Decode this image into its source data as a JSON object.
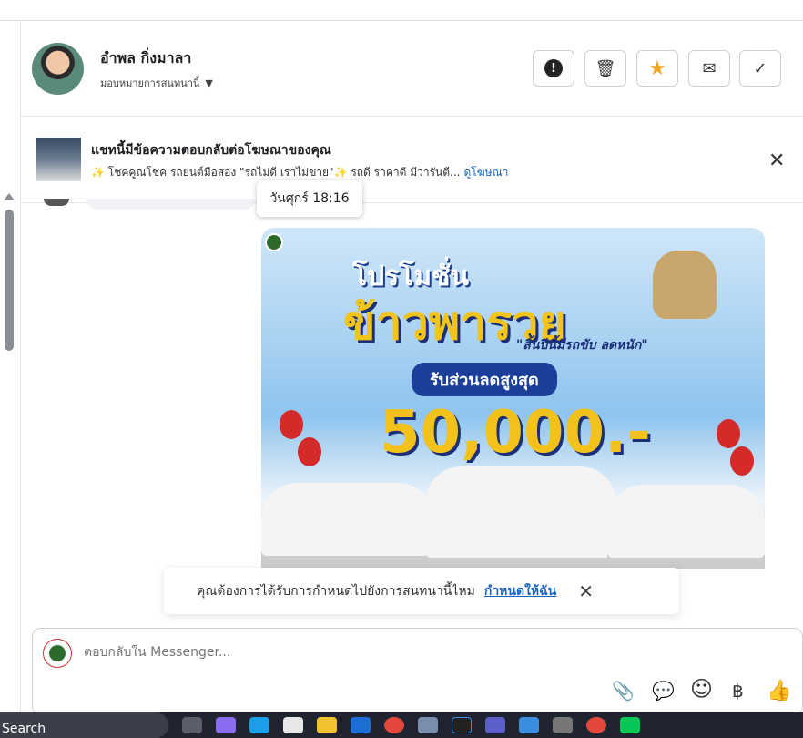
{
  "header": {
    "name": "อำพล กิ่งมาลา",
    "assign_label": "มอบหมายการสนทนานี้"
  },
  "actions": [
    {
      "name": "report",
      "icon": "exclamation-icon",
      "glyph": "!"
    },
    {
      "name": "delete",
      "icon": "trash-icon",
      "glyph": "🗑"
    },
    {
      "name": "star",
      "icon": "star-icon",
      "glyph": "★"
    },
    {
      "name": "mark-unread",
      "icon": "envelope-icon",
      "glyph": "✉"
    },
    {
      "name": "done",
      "icon": "check-icon",
      "glyph": "✓"
    }
  ],
  "ad_banner": {
    "title": "แชทนี้มีข้อความตอบกลับต่อโฆษณาของคุณ",
    "sparkle": "✨",
    "text": "โชคคูณโชค รถยนต์มือสอง \"รถไม่ดี เราไม่ขาย\"✨ รถดี ราคาดี มีวารันตี...",
    "link": "ดูโฆษณา",
    "close": "✕"
  },
  "tooltip": "วันศุกร์ 18:16",
  "promo": {
    "line1": "โปรโมชั่น",
    "line2": "ข้าวพารวย",
    "line3": "\"สิ้นปีนี้มีรถขับ ลดหนัก\"",
    "line4": "รับส่วนลดสูงสุด",
    "line5": "50,000.-"
  },
  "toast": {
    "text": "คุณต้องการได้รับการกำหนดไปยังการสนทนานี้ไหม",
    "link": "กำหนดให้ฉัน",
    "close": "✕"
  },
  "composer": {
    "placeholder": "ตอบกลับใน Messenger...",
    "icons": {
      "attach": "📎",
      "saved_replies": "💬",
      "emoji": "☺",
      "currency": "฿",
      "like": "👍"
    }
  },
  "taskbar": {
    "search": "Search"
  },
  "colors": {
    "accent": "#1a66c2",
    "star": "#f5a623"
  }
}
